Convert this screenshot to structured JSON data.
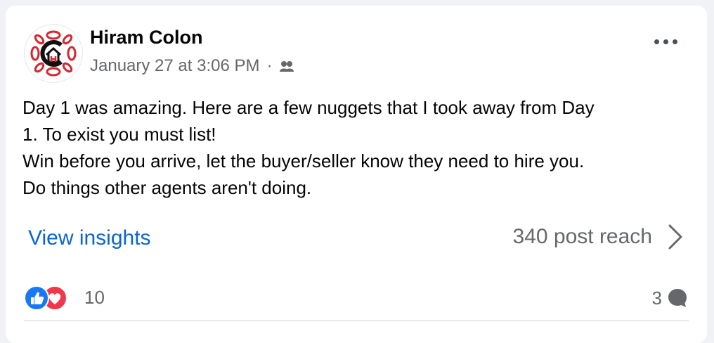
{
  "post": {
    "author": "Hiram Colon",
    "timestamp": "January 27 at 3:06 PM",
    "separator": "·",
    "audience_icon": "friends-icon",
    "more_icon": "more-options-icon",
    "text_lines": [
      "Day 1 was amazing. Here are a few nuggets that I took away from Day",
      "1. To exist you must list!",
      "Win before you arrive, let the buyer/seller know they need to hire you.",
      "Do things other agents aren't doing."
    ]
  },
  "insights": {
    "link_label": "View insights",
    "reach_label": "340 post reach",
    "chevron_icon": "chevron-right-icon"
  },
  "reactions": {
    "icons": [
      "like-icon",
      "love-icon"
    ],
    "count": "10"
  },
  "comments": {
    "count": "3",
    "icon": "comment-icon"
  },
  "colors": {
    "link": "#0866d3",
    "like": "#1877f2",
    "love": "#f0384b",
    "secondary_text": "#65676b"
  }
}
